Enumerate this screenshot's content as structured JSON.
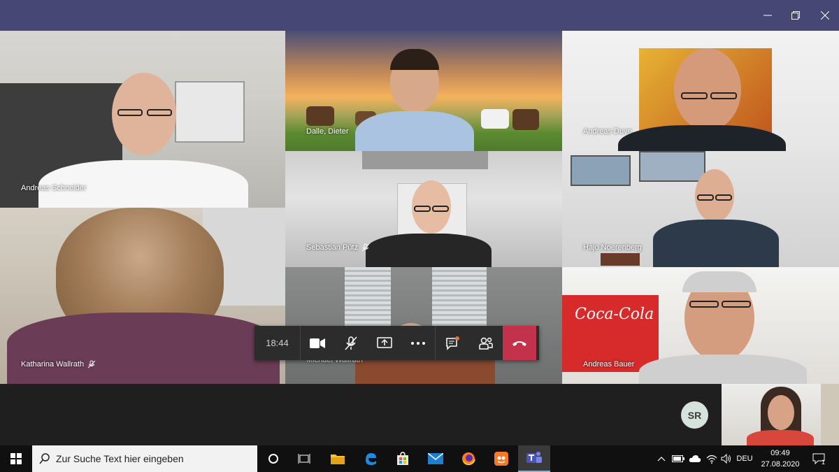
{
  "window": {
    "minimize_icon": "minimize-icon",
    "maximize_icon": "restore-icon",
    "close_icon": "close-icon"
  },
  "participants": [
    {
      "name": "Andreas Schneider",
      "muted": false
    },
    {
      "name": "Dalle, Dieter",
      "muted": false
    },
    {
      "name": "Andreas Duve",
      "muted": false
    },
    {
      "name": "Sebastian Pütz",
      "muted": true
    },
    {
      "name": "Hajo Noerenberg",
      "muted": false
    },
    {
      "name": "Katharina Wallrath",
      "muted": true
    },
    {
      "name": "Michael Wallrath",
      "muted": false
    },
    {
      "name": "Andreas Bauer",
      "muted": false
    }
  ],
  "controls": {
    "timer": "18:44",
    "buttons": [
      "camera-icon",
      "mic-off-icon",
      "share-screen-icon",
      "more-icon",
      "chat-icon",
      "participants-icon",
      "hang-up-icon"
    ]
  },
  "avatar_initials": "SR",
  "taskbar": {
    "search_placeholder": "Zur Suche Text hier eingeben",
    "language": "DEU",
    "time": "09:49",
    "date": "27.08.2020",
    "notification_count": "1"
  },
  "colors": {
    "titlebar": "#464775",
    "hangup": "#c4314b",
    "taskbar": "#101010"
  }
}
